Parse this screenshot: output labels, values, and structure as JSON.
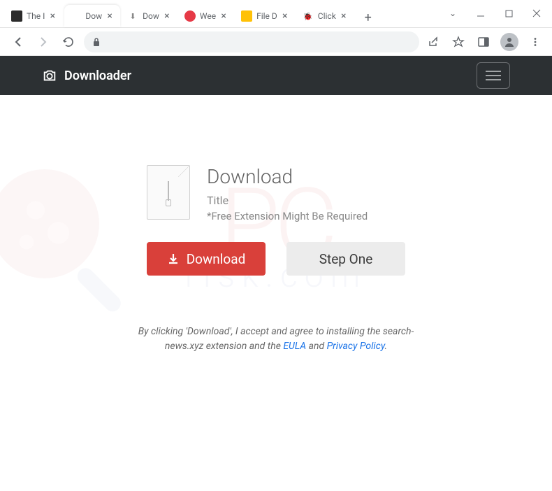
{
  "tabs": [
    {
      "title": "The I",
      "favicon_bg": "#2b2b2b"
    },
    {
      "title": "Dow",
      "favicon_bg": "#ffffff"
    },
    {
      "title": "Dow",
      "favicon_bg": "#f0f0f0"
    },
    {
      "title": "Wee",
      "favicon_bg": "#e63946"
    },
    {
      "title": "File D",
      "favicon_bg": "#ffc107"
    },
    {
      "title": "Click",
      "favicon_bg": "#ffffff"
    }
  ],
  "active_tab_index": 1,
  "header": {
    "brand": "Downloader"
  },
  "download": {
    "heading": "Download",
    "title": "Title",
    "note": "*Free Extension Might Be Required"
  },
  "buttons": {
    "download": "Download",
    "step_one": "Step One"
  },
  "disclaimer": {
    "pre": "By clicking 'Download', I accept and agree to installing the search-news.xyz extension and the ",
    "eula": "EULA",
    "mid": " and ",
    "privacy": "Privacy Policy",
    "post": "."
  },
  "watermark": {
    "main": "PC",
    "sub": "risk.com"
  }
}
